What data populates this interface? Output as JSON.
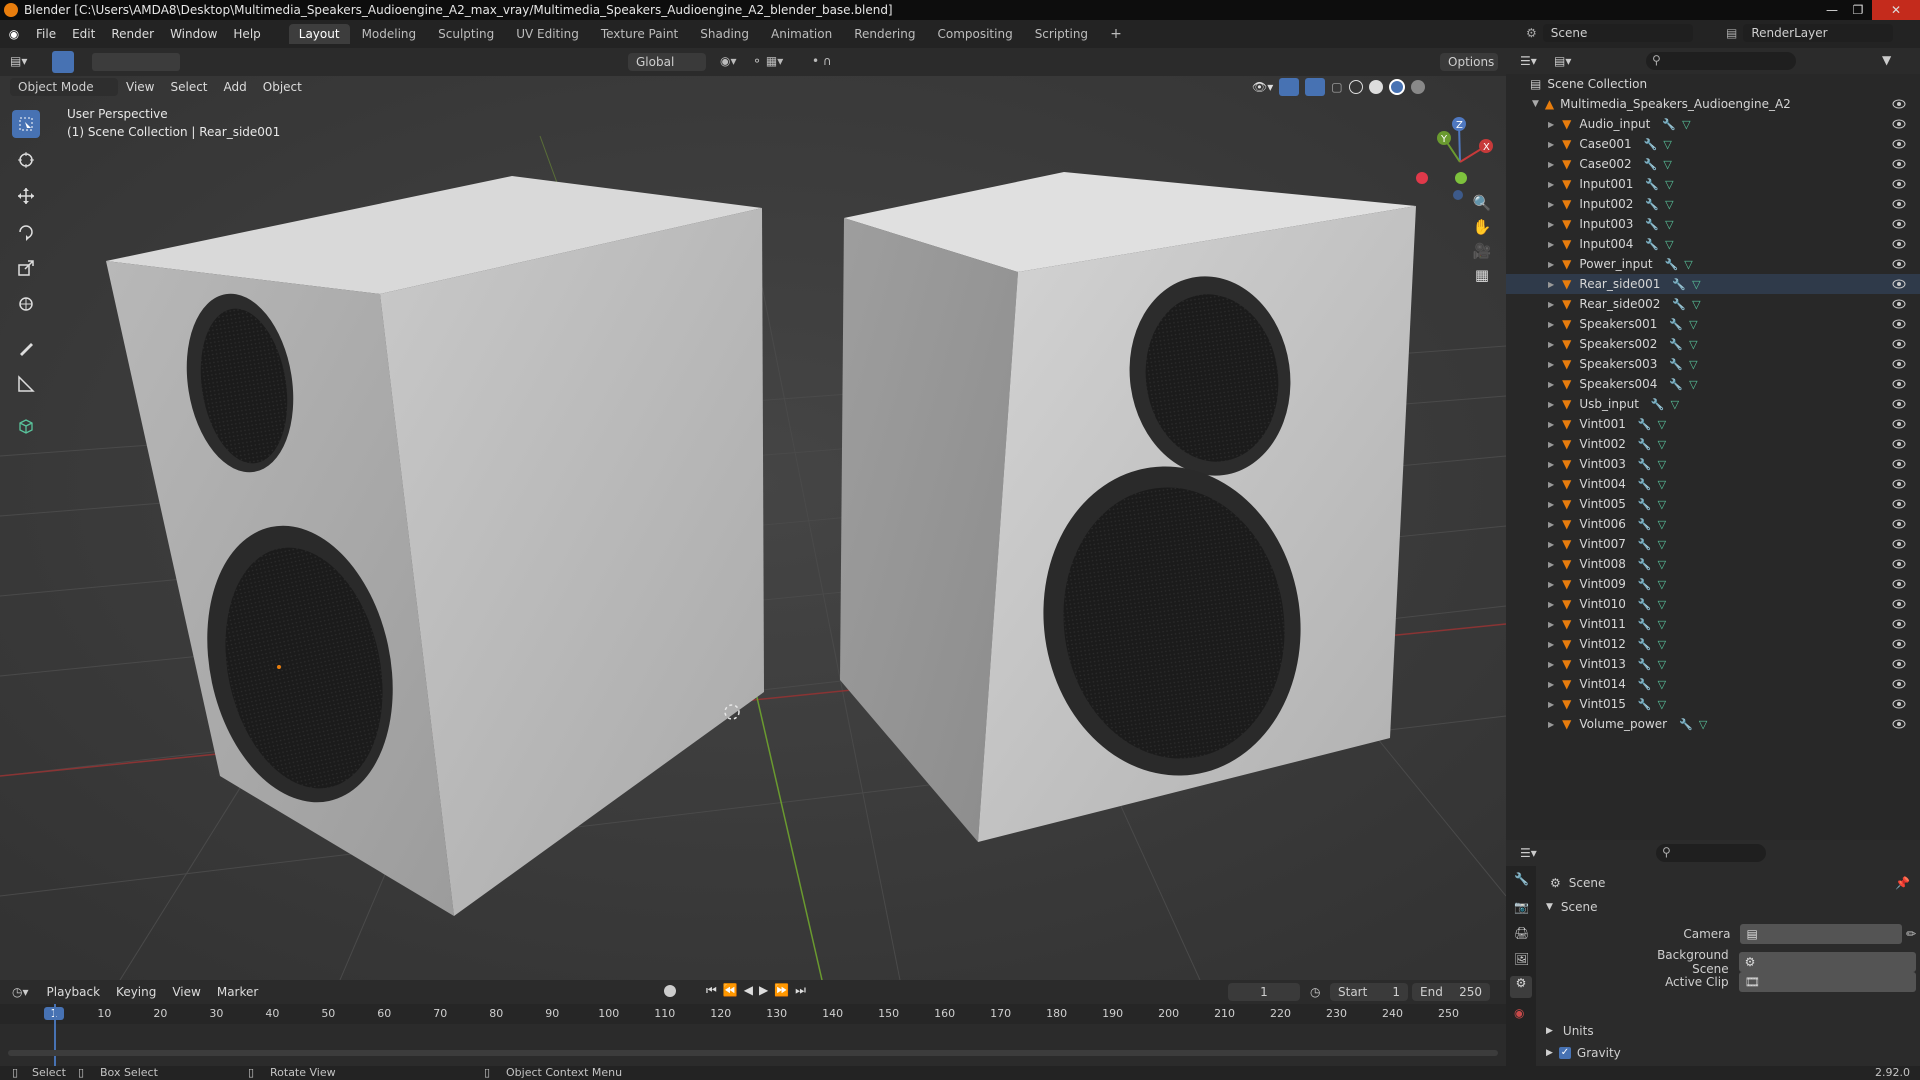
{
  "window": {
    "title": "Blender [C:\\Users\\AMDA8\\Desktop\\Multimedia_Speakers_Audioengine_A2_max_vray/Multimedia_Speakers_Audioengine_A2_blender_base.blend]"
  },
  "menu": [
    "File",
    "Edit",
    "Render",
    "Window",
    "Help"
  ],
  "workspaces": [
    {
      "label": "Layout",
      "active": true
    },
    {
      "label": "Modeling"
    },
    {
      "label": "Sculpting"
    },
    {
      "label": "UV Editing"
    },
    {
      "label": "Texture Paint"
    },
    {
      "label": "Shading"
    },
    {
      "label": "Animation"
    },
    {
      "label": "Rendering"
    },
    {
      "label": "Compositing"
    },
    {
      "label": "Scripting"
    }
  ],
  "scene_selector": {
    "scene": "Scene",
    "view_layer": "RenderLayer"
  },
  "viewport_header": {
    "transform_orientation": "Global",
    "options_label": "Options",
    "mode": "Object Mode",
    "menus": [
      "View",
      "Select",
      "Add",
      "Object"
    ]
  },
  "viewport": {
    "perspective_label": "User Perspective",
    "collection_label": "(1) Scene Collection | Rear_side001"
  },
  "navigation_gizmo": {
    "axes": [
      "Z",
      "Y",
      "X"
    ]
  },
  "outliner": {
    "root": "Scene Collection",
    "collection": "Multimedia_Speakers_Audioengine_A2",
    "items": [
      "Audio_input",
      "Case001",
      "Case002",
      "Input001",
      "Input002",
      "Input003",
      "Input004",
      "Power_input",
      "Rear_side001",
      "Rear_side002",
      "Speakers001",
      "Speakers002",
      "Speakers003",
      "Speakers004",
      "Usb_input",
      "Vint001",
      "Vint002",
      "Vint003",
      "Vint004",
      "Vint005",
      "Vint006",
      "Vint007",
      "Vint008",
      "Vint009",
      "Vint010",
      "Vint011",
      "Vint012",
      "Vint013",
      "Vint014",
      "Vint015",
      "Volume_power"
    ],
    "selected": "Rear_side001"
  },
  "properties": {
    "context": "Scene",
    "panel_title": "Scene",
    "fields": [
      {
        "label": "Camera"
      },
      {
        "label": "Background Scene"
      },
      {
        "label": "Active Clip"
      }
    ],
    "subpanels": [
      {
        "label": "Units",
        "checkbox": false
      },
      {
        "label": "Gravity",
        "checkbox": true
      }
    ]
  },
  "timeline": {
    "menus": [
      "Playback",
      "Keying",
      "View",
      "Marker"
    ],
    "current_frame": "1",
    "start_label": "Start",
    "start": "1",
    "end_label": "End",
    "end": "250",
    "ruler": [
      "1",
      "10",
      "20",
      "30",
      "40",
      "50",
      "60",
      "70",
      "80",
      "90",
      "100",
      "110",
      "120",
      "130",
      "140",
      "150",
      "160",
      "170",
      "180",
      "190",
      "200",
      "210",
      "220",
      "230",
      "240",
      "250"
    ]
  },
  "statusbar": {
    "select": "Select",
    "box_select": "Box Select",
    "rotate": "Rotate View",
    "context_menu": "Object Context Menu",
    "version": "2.92.0"
  },
  "colors": {
    "accent": "#4772b3",
    "orange": "#e87d0d",
    "mesh_teal": "#59c39b",
    "axis_red": "#c73a3a",
    "axis_green": "#6a9a2f"
  }
}
